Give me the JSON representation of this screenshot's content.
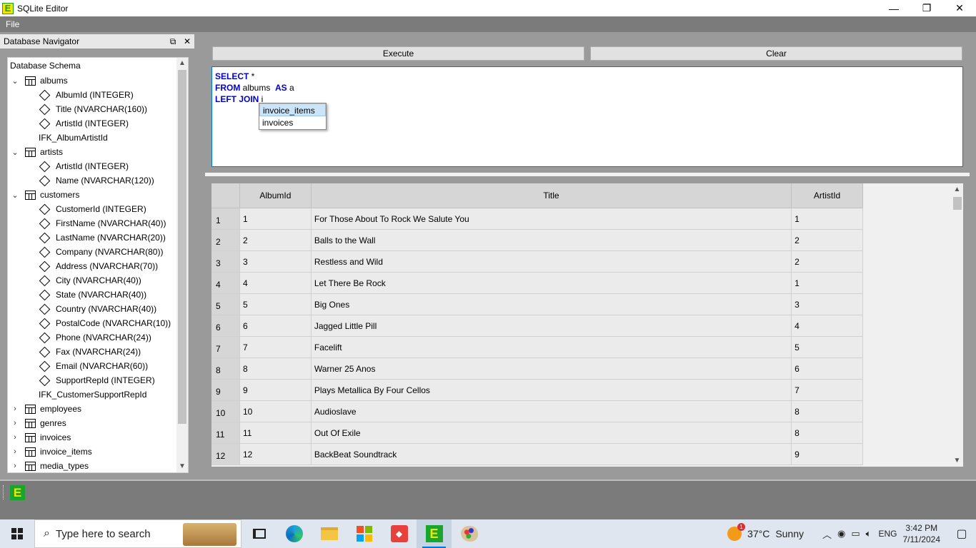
{
  "window": {
    "title": "SQLite Editor",
    "controls": {
      "minimize": "—",
      "maximize": "❐",
      "close": "✕"
    }
  },
  "menu": {
    "items": [
      "File"
    ]
  },
  "navigator": {
    "title": "Database Navigator",
    "float_icon": "⧉",
    "close_icon": "✕",
    "root_label": "Database Schema",
    "tree": [
      {
        "type": "table",
        "expanded": true,
        "label": "albums"
      },
      {
        "type": "column",
        "label": "AlbumId (INTEGER)"
      },
      {
        "type": "column",
        "label": "Title (NVARCHAR(160))"
      },
      {
        "type": "column",
        "label": "ArtistId (INTEGER)"
      },
      {
        "type": "fk",
        "label": "IFK_AlbumArtistId"
      },
      {
        "type": "table",
        "expanded": true,
        "label": "artists"
      },
      {
        "type": "column",
        "label": "ArtistId (INTEGER)"
      },
      {
        "type": "column",
        "label": "Name (NVARCHAR(120))"
      },
      {
        "type": "table",
        "expanded": true,
        "label": "customers"
      },
      {
        "type": "column",
        "label": "CustomerId (INTEGER)"
      },
      {
        "type": "column",
        "label": "FirstName (NVARCHAR(40))"
      },
      {
        "type": "column",
        "label": "LastName (NVARCHAR(20))"
      },
      {
        "type": "column",
        "label": "Company (NVARCHAR(80))"
      },
      {
        "type": "column",
        "label": "Address (NVARCHAR(70))"
      },
      {
        "type": "column",
        "label": "City (NVARCHAR(40))"
      },
      {
        "type": "column",
        "label": "State (NVARCHAR(40))"
      },
      {
        "type": "column",
        "label": "Country (NVARCHAR(40))"
      },
      {
        "type": "column",
        "label": "PostalCode (NVARCHAR(10))"
      },
      {
        "type": "column",
        "label": "Phone (NVARCHAR(24))"
      },
      {
        "type": "column",
        "label": "Fax (NVARCHAR(24))"
      },
      {
        "type": "column",
        "label": "Email (NVARCHAR(60))"
      },
      {
        "type": "column",
        "label": "SupportRepId (INTEGER)"
      },
      {
        "type": "fk",
        "label": "IFK_CustomerSupportRepId"
      },
      {
        "type": "table",
        "expanded": false,
        "label": "employees"
      },
      {
        "type": "table",
        "expanded": false,
        "label": "genres"
      },
      {
        "type": "table",
        "expanded": false,
        "label": "invoices"
      },
      {
        "type": "table",
        "expanded": false,
        "label": "invoice_items"
      },
      {
        "type": "table",
        "expanded": false,
        "label": "media_types"
      }
    ]
  },
  "toolbar": {
    "execute_label": "Execute",
    "clear_label": "Clear"
  },
  "editor": {
    "lines": [
      {
        "kw": "SELECT",
        "text": " *"
      },
      {
        "kw": "FROM",
        "text": " albums  ",
        "kw2": "AS",
        "text2": " a"
      },
      {
        "kw": "LEFT JOIN",
        "text": " i"
      }
    ],
    "autocomplete": [
      "invoice_items",
      "invoices"
    ]
  },
  "grid": {
    "columns": [
      "",
      "AlbumId",
      "Title",
      "ArtistId"
    ],
    "rows": [
      [
        "1",
        "1",
        "For Those About To Rock We Salute You",
        "1"
      ],
      [
        "2",
        "2",
        "Balls to the Wall",
        "2"
      ],
      [
        "3",
        "3",
        "Restless and Wild",
        "2"
      ],
      [
        "4",
        "4",
        "Let There Be Rock",
        "1"
      ],
      [
        "5",
        "5",
        "Big Ones",
        "3"
      ],
      [
        "6",
        "6",
        "Jagged Little Pill",
        "4"
      ],
      [
        "7",
        "7",
        "Facelift",
        "5"
      ],
      [
        "8",
        "8",
        "Warner 25 Anos",
        "6"
      ],
      [
        "9",
        "9",
        "Plays Metallica By Four Cellos",
        "7"
      ],
      [
        "10",
        "10",
        "Audioslave",
        "8"
      ],
      [
        "11",
        "11",
        "Out Of Exile",
        "8"
      ],
      [
        "12",
        "12",
        "BackBeat Soundtrack",
        "9"
      ]
    ]
  },
  "taskbar": {
    "search_placeholder": "Type here to search",
    "weather_temp": "37°C",
    "weather_desc": "Sunny",
    "weather_badge": "1",
    "language": "ENG",
    "time": "3:42 PM",
    "date": "7/11/2024"
  }
}
